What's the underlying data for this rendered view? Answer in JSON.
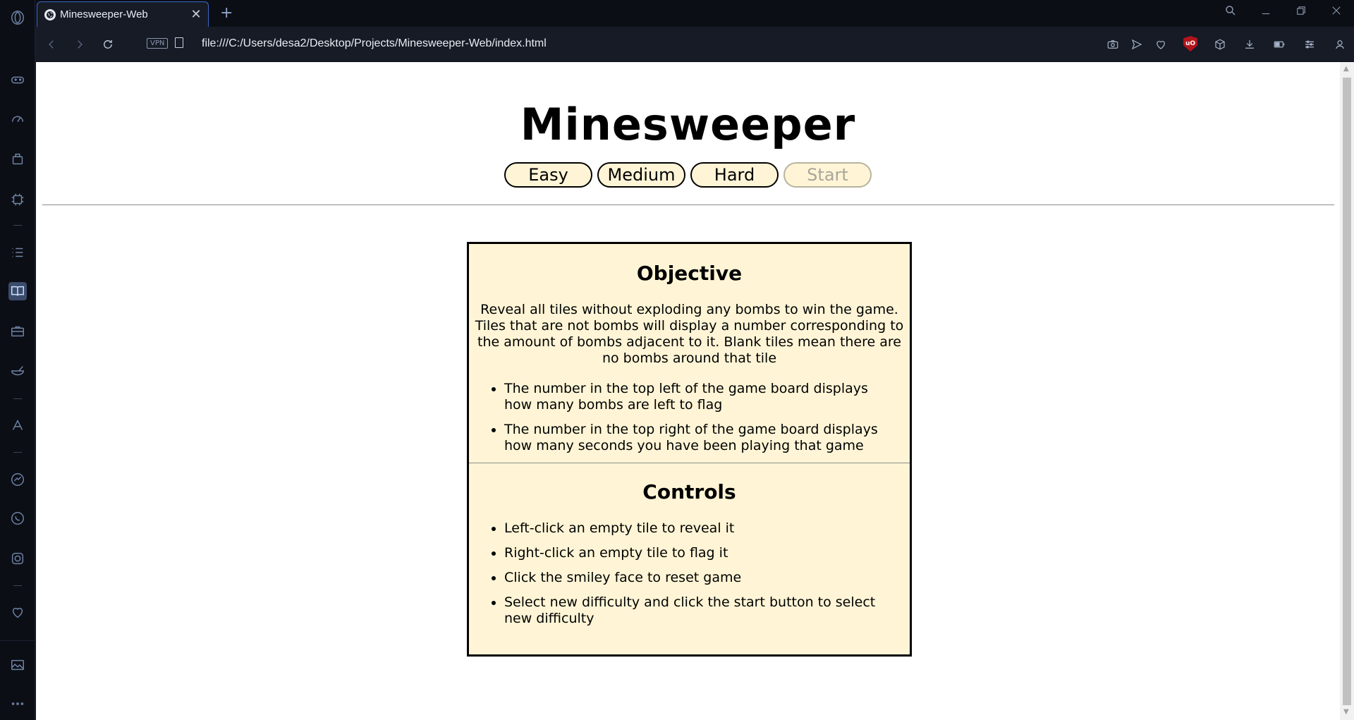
{
  "browser": {
    "tab": {
      "title": "Minesweeper-Web",
      "close": "✕"
    },
    "new_tab": "+",
    "url": "file:///C:/Users/desa2/Desktop/Projects/Minesweeper-Web/index.html",
    "vpn_label": "VPN",
    "ublock_label": "uO"
  },
  "page": {
    "title": "Minesweeper",
    "buttons": {
      "easy": "Easy",
      "medium": "Medium",
      "hard": "Hard",
      "start": "Start"
    },
    "objective": {
      "heading": "Objective",
      "text": "Reveal all tiles without exploding any bombs to win the game. Tiles that are not bombs will display a number corresponding to the amount of bombs adjacent to it. Blank tiles mean there are no bombs around that tile",
      "items": [
        "The number in the top left of the game board displays how many bombs are left to flag",
        "The number in the top right of the game board displays how many seconds you have been playing that game"
      ]
    },
    "controls": {
      "heading": "Controls",
      "items": [
        "Left-click an empty tile to reveal it",
        "Right-click an empty tile to flag it",
        "Click the smiley face to reset game",
        "Select new difficulty and click the start button to select new difficulty"
      ]
    }
  }
}
